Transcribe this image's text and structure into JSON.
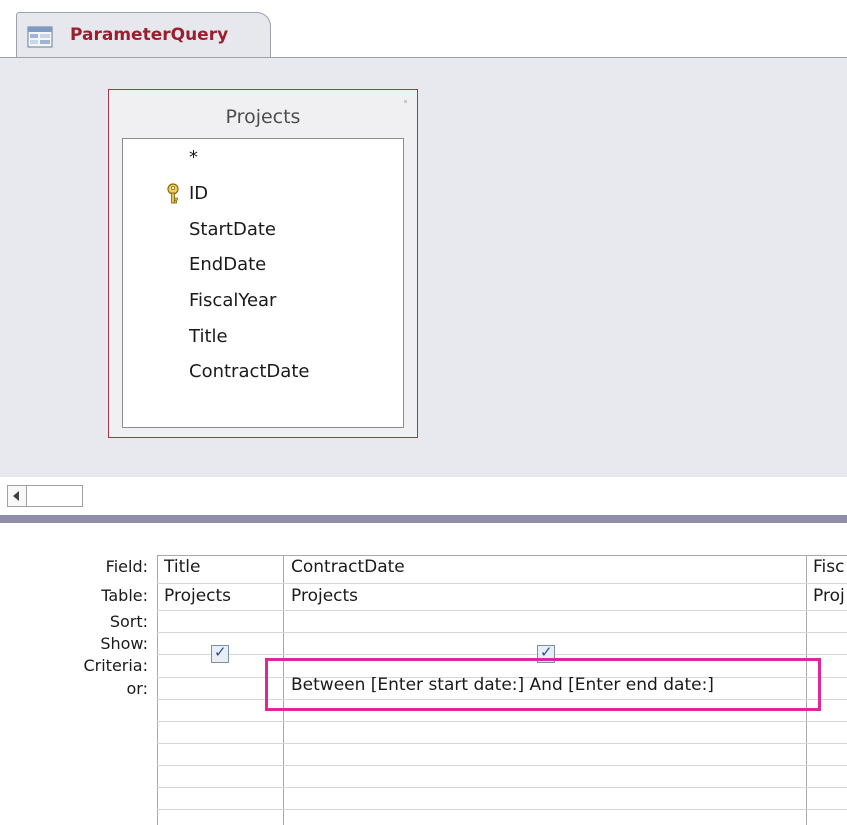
{
  "tab": {
    "label": "ParameterQuery"
  },
  "table": {
    "title": "Projects",
    "fields": [
      "*",
      "ID",
      "StartDate",
      "EndDate",
      "FiscalYear",
      "Title",
      "ContractDate"
    ]
  },
  "grid": {
    "row_labels": [
      "Field:",
      "Table:",
      "Sort:",
      "Show:",
      "Criteria:",
      "or:"
    ],
    "columns": [
      {
        "field": "Title",
        "table": "Projects",
        "show": true,
        "criteria": ""
      },
      {
        "field": "ContractDate",
        "table": "Projects",
        "show": true,
        "criteria": "Between [Enter start date:] And [Enter end date:]"
      },
      {
        "field": "Fisc",
        "table": "Proj"
      }
    ]
  },
  "colors": {
    "tab_label": "#9b1f2e",
    "table_border": "#a23a44",
    "highlight": "#e0279a",
    "splitter": "#8f8da7"
  }
}
